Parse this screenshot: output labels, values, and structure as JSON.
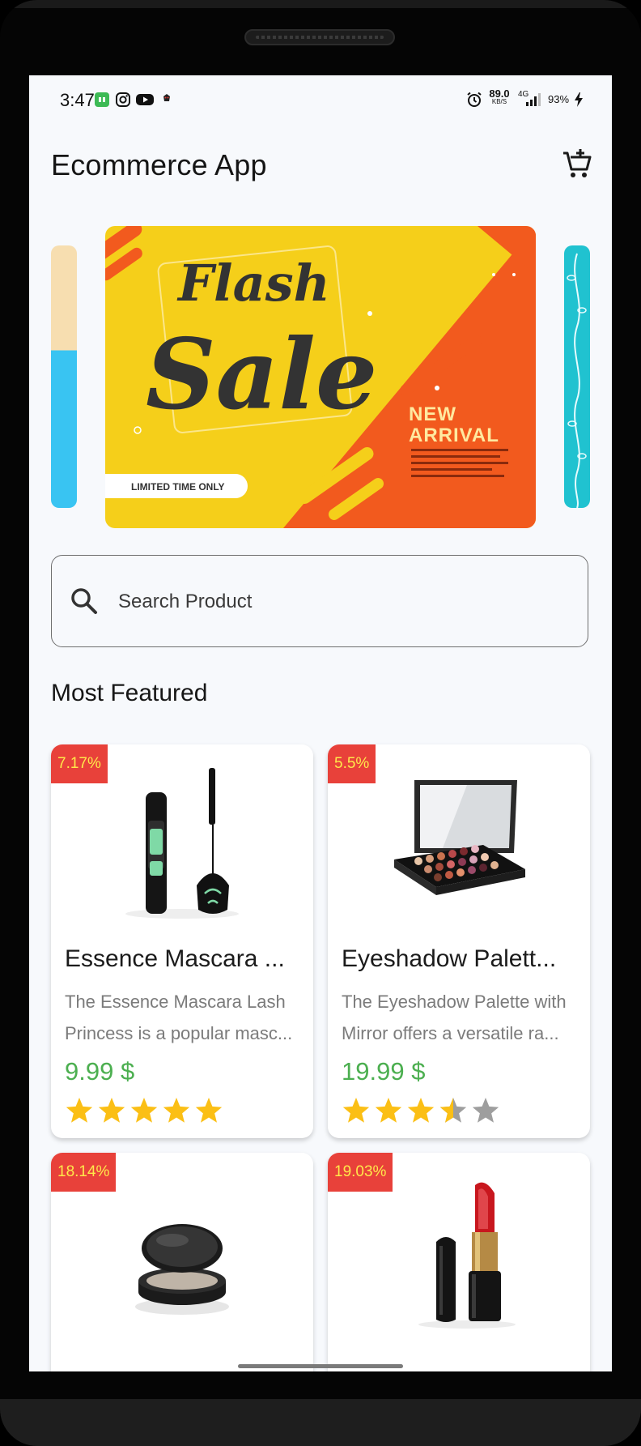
{
  "status_bar": {
    "time": "3:47",
    "net_speed": "89.0",
    "net_unit": "KB/S",
    "network": "4G",
    "battery": "93%",
    "icons": [
      "app-icon",
      "instagram-icon",
      "youtube-icon",
      "notification-icon",
      "alarm-icon",
      "signal-icon",
      "charging-icon"
    ]
  },
  "app_bar": {
    "title": "Ecommerce App",
    "cart_icon": "cart-add-icon"
  },
  "banner": {
    "headline_1": "Flash",
    "headline_2": "Sale",
    "tag_1": "NEW",
    "tag_2": "ARRIVAL",
    "pill": "LIMITED TIME ONLY",
    "colors": {
      "yellow": "#f5cf1a",
      "orange": "#f25a1e"
    }
  },
  "search": {
    "placeholder": "Search Product",
    "value": ""
  },
  "section": {
    "title": "Most Featured"
  },
  "products": [
    {
      "badge": "7.17%",
      "title": "Essence Mascara ...",
      "desc_line_1": "The Essence Mascara Lash",
      "desc_line_2": "Princess is a popular masc...",
      "price": "9.99 $",
      "rating": 5,
      "image": "mascara"
    },
    {
      "badge": "5.5%",
      "title": "Eyeshadow Palett...",
      "desc_line_1": "The Eyeshadow Palette with",
      "desc_line_2": "Mirror offers a versatile ra...",
      "price": "19.99 $",
      "rating": 3.5,
      "image": "eyeshadow-palette"
    },
    {
      "badge": "18.14%",
      "image": "powder-compact"
    },
    {
      "badge": "19.03%",
      "image": "lipstick"
    }
  ],
  "colors": {
    "accent_price": "#4caf50",
    "badge_bg": "#e8413a",
    "badge_text": "#ffe84a",
    "star": "#fbbf15",
    "star_empty": "#9e9e9e"
  }
}
